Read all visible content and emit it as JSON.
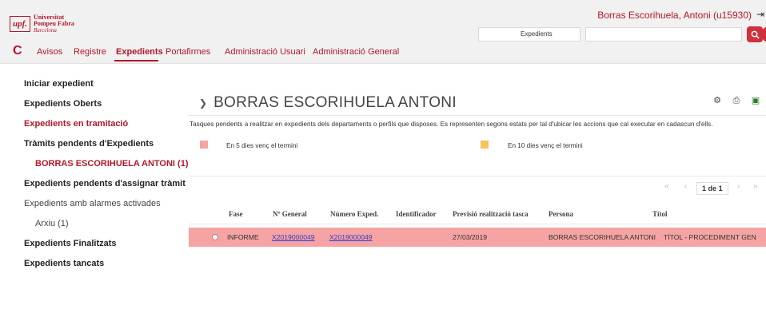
{
  "header": {
    "logo": {
      "mark": "upf.",
      "line1": "Universitat",
      "line2": "Pompeu Fabra",
      "line3": "Barcelona"
    },
    "user": "Borras Escorihuela, Antoni (u15930)",
    "search_scope": "Expedients",
    "search_placeholder": ""
  },
  "nav": {
    "items": [
      "Avisos",
      "Registre",
      "Expedients",
      "Portafirmes",
      "Administració Usuari",
      "Administració General"
    ],
    "active": "Expedients"
  },
  "sidebar": {
    "items": [
      "Iniciar expedient",
      "Expedients Oberts",
      "Expedients en tramitació",
      "Tràmits pendents d'Expedients",
      "BORRAS ESCORIHUELA ANTONI (1)",
      "Expedients pendents d'assignar tràmit",
      "Expedients amb alarmes activades",
      "Arxiu (1)",
      "Expedients Finalitzats",
      "Expedients tancats"
    ]
  },
  "main": {
    "title": "BORRAS ESCORIHUELA ANTONI",
    "description": "Tasques pendents a realitzar en expedients dels departaments o perfils que disposes. Es representen segons estats per tal d'ubicar les accions que cal executar en cadascun d'ells.",
    "legend": [
      {
        "label": "En 5 dies venç el termini",
        "color": "#f5a3a3"
      },
      {
        "label": "En 10 dies venç el termini",
        "color": "#f7c35c"
      }
    ],
    "pager": {
      "current": "1",
      "of_label": "de",
      "total": "1"
    },
    "columns": [
      "Fase",
      "Nº General",
      "Número Exped.",
      "Identificador",
      "Previsió realització tasca",
      "Persona",
      "Títol"
    ],
    "rows": [
      {
        "fase": "INFORME",
        "n_general": "X2019000049",
        "numero_exped": "X2019000049",
        "identificador": "",
        "previsio": "27/03/2019",
        "persona": "BORRAS ESCORIHUELA ANTONI",
        "titol": "TÍTOL - PROCEDIMENT GEN"
      }
    ]
  },
  "colors": {
    "brand": "#b2182b",
    "row_highlight": "#f5a3a3",
    "warn": "#f7c35c"
  }
}
